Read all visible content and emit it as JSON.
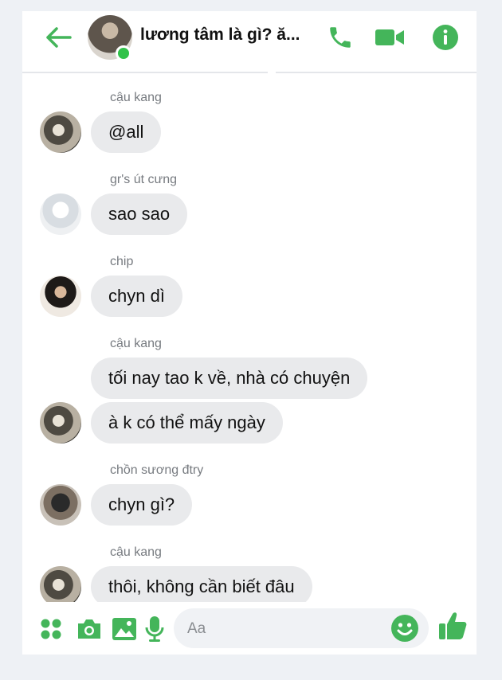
{
  "header": {
    "title": "lương tâm là gì? ă...",
    "online": true,
    "icons": [
      "back-arrow-icon",
      "phone-icon",
      "video-camera-icon",
      "info-icon"
    ]
  },
  "accent_color": "#44b55a",
  "messages": [
    {
      "sender": "cậu kang",
      "avatar": "kang",
      "bubbles": [
        "@all"
      ]
    },
    {
      "sender": "gr's út cưng",
      "avatar": "gr",
      "bubbles": [
        "sao sao"
      ]
    },
    {
      "sender": "chip",
      "avatar": "chip",
      "bubbles": [
        "chyn dì"
      ]
    },
    {
      "sender": "cậu kang",
      "avatar": "kang",
      "bubbles": [
        "tối nay tao k về, nhà có chuyện",
        "à k có thể mấy ngày"
      ]
    },
    {
      "sender": "chồn sương đtry",
      "avatar": "chon",
      "bubbles": [
        "chyn gì?"
      ]
    },
    {
      "sender": "cậu kang",
      "avatar": "kang",
      "bubbles": [
        "thôi, không cần biết đâu"
      ]
    }
  ],
  "composer": {
    "placeholder": "Aa",
    "icons": [
      "apps-grid-icon",
      "camera-icon",
      "image-icon",
      "microphone-icon",
      "emoji-icon",
      "thumbs-up-icon"
    ]
  }
}
